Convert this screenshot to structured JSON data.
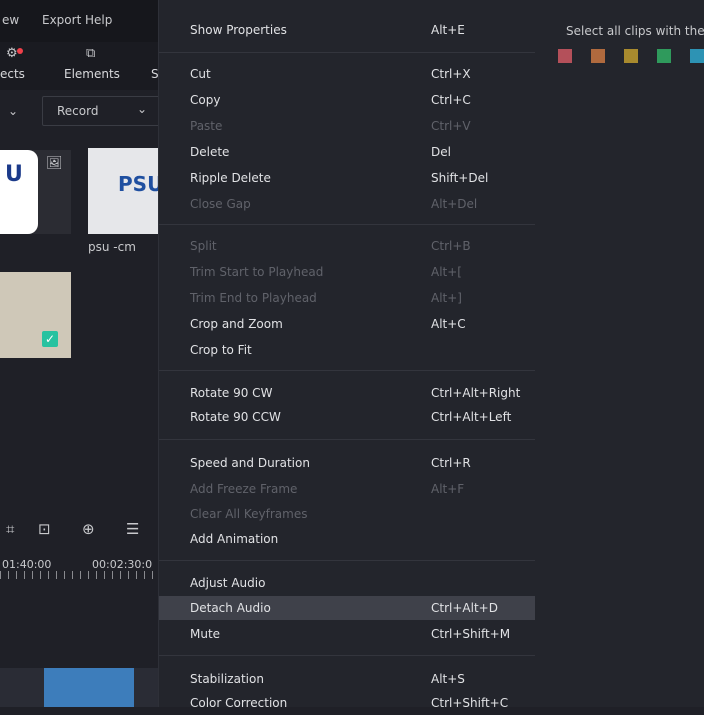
{
  "menubar": {
    "items": [
      "ew",
      "Export",
      "Help"
    ]
  },
  "tabs": {
    "effects": "ects",
    "elements": "Elements",
    "third": "S"
  },
  "filter": {
    "record": "Record"
  },
  "media": {
    "thumb2_label": "psu -cm",
    "thumb1_text": "U",
    "thumb2_text": "PSU"
  },
  "timeline": {
    "t1": "01:40:00",
    "t2": "00:02:30:0"
  },
  "context_menu": {
    "items": [
      {
        "label": "Show Properties",
        "shortcut": "Alt+E",
        "enabled": true
      },
      {
        "label": "Cut",
        "shortcut": "Ctrl+X",
        "enabled": true
      },
      {
        "label": "Copy",
        "shortcut": "Ctrl+C",
        "enabled": true
      },
      {
        "label": "Paste",
        "shortcut": "Ctrl+V",
        "enabled": false
      },
      {
        "label": "Delete",
        "shortcut": "Del",
        "enabled": true
      },
      {
        "label": "Ripple Delete",
        "shortcut": "Shift+Del",
        "enabled": true
      },
      {
        "label": "Close Gap",
        "shortcut": "Alt+Del",
        "enabled": false
      },
      {
        "label": "Split",
        "shortcut": "Ctrl+B",
        "enabled": false
      },
      {
        "label": "Trim Start to Playhead",
        "shortcut": "Alt+[",
        "enabled": false
      },
      {
        "label": "Trim End to Playhead",
        "shortcut": "Alt+]",
        "enabled": false
      },
      {
        "label": "Crop and Zoom",
        "shortcut": "Alt+C",
        "enabled": true
      },
      {
        "label": "Crop to Fit",
        "shortcut": "",
        "enabled": true
      },
      {
        "label": "Rotate 90 CW",
        "shortcut": "Ctrl+Alt+Right",
        "enabled": true
      },
      {
        "label": "Rotate 90 CCW",
        "shortcut": "Ctrl+Alt+Left",
        "enabled": true
      },
      {
        "label": "Speed and Duration",
        "shortcut": "Ctrl+R",
        "enabled": true
      },
      {
        "label": "Add Freeze Frame",
        "shortcut": "Alt+F",
        "enabled": false
      },
      {
        "label": "Clear All Keyframes",
        "shortcut": "",
        "enabled": false
      },
      {
        "label": "Add Animation",
        "shortcut": "",
        "enabled": true
      },
      {
        "label": "Adjust Audio",
        "shortcut": "",
        "enabled": true
      },
      {
        "label": "Detach Audio",
        "shortcut": "Ctrl+Alt+D",
        "enabled": true,
        "highlighted": true
      },
      {
        "label": "Mute",
        "shortcut": "Ctrl+Shift+M",
        "enabled": true
      },
      {
        "label": "Stabilization",
        "shortcut": "Alt+S",
        "enabled": true
      },
      {
        "label": "Color Correction",
        "shortcut": "Ctrl+Shift+C",
        "enabled": true
      }
    ]
  },
  "color_panel": {
    "text": "Select all clips with the",
    "swatches": [
      "#b4505a",
      "#b06a3e",
      "#a88a2e",
      "#2f9a5c",
      "#2d93b4"
    ]
  }
}
